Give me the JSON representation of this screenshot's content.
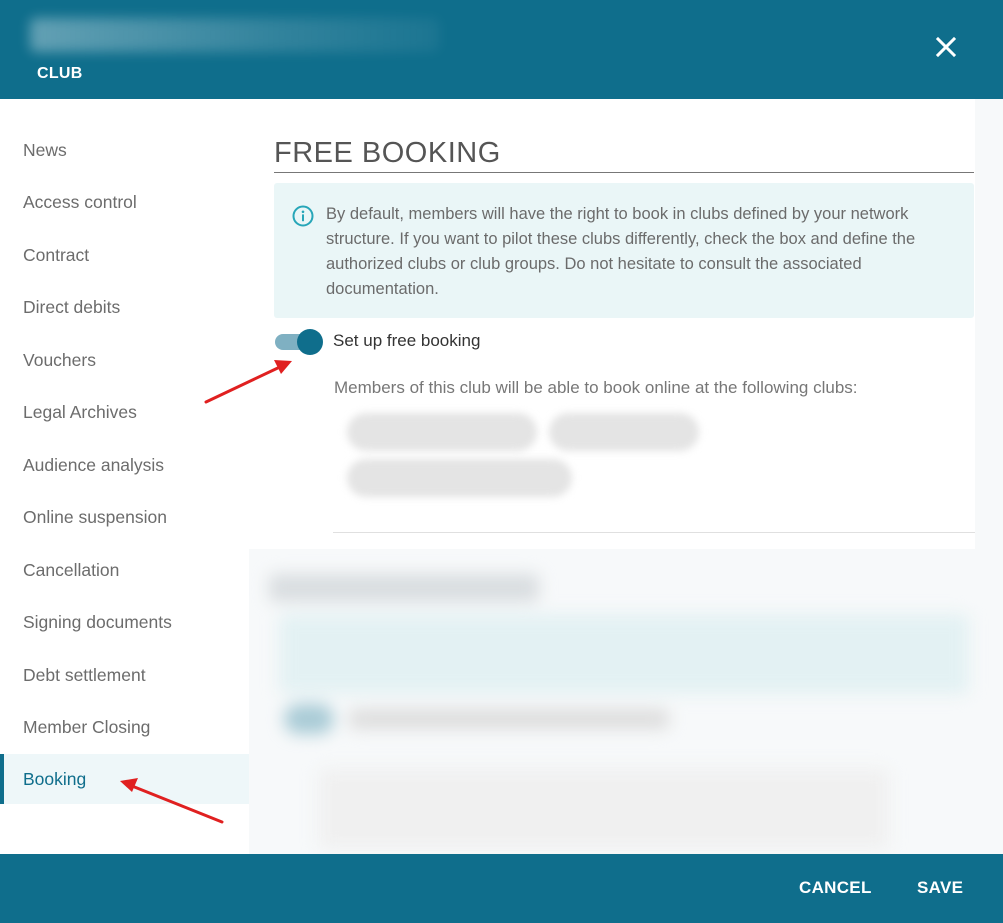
{
  "header": {
    "section": "CLUB",
    "close_icon": "close-icon"
  },
  "sidebar": {
    "items": [
      {
        "label": "News"
      },
      {
        "label": "Access control"
      },
      {
        "label": "Contract"
      },
      {
        "label": "Direct debits"
      },
      {
        "label": "Vouchers"
      },
      {
        "label": "Legal Archives"
      },
      {
        "label": "Audience analysis"
      },
      {
        "label": "Online suspension"
      },
      {
        "label": "Cancellation"
      },
      {
        "label": "Signing documents"
      },
      {
        "label": "Debt settlement"
      },
      {
        "label": "Member Closing"
      },
      {
        "label": "Booking"
      }
    ],
    "active_item": "Booking"
  },
  "main": {
    "title": "FREE BOOKING",
    "info_icon": "info-circle-icon",
    "info_text": "By default, members will have the right to book in clubs defined by your network structure. If you want to pilot these clubs differently, check the box and define the authorized clubs or club groups. Do not hesitate to consult the associated documentation.",
    "toggle_label": "Set up free booking",
    "toggle_on": true,
    "clubs_text": "Members of this club will be able to book online at the following clubs:"
  },
  "footer": {
    "cancel_label": "CANCEL",
    "save_label": "SAVE"
  },
  "colors": {
    "primary": "#0f6e8c",
    "info_bg": "#eaf6f7",
    "annotation_arrow": "#e02020"
  }
}
